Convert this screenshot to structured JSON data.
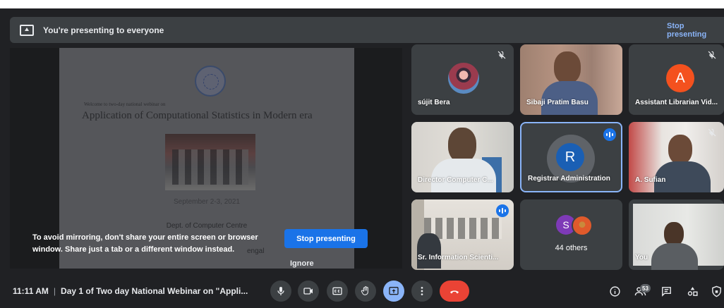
{
  "banner": {
    "text": "You're presenting to everyone",
    "stop_label": "Stop presenting"
  },
  "slide": {
    "welcome": "Welcome to two-day national webinar on",
    "title": "Application of Computational Statistics in Modern era",
    "dates": "September 2-3, 2021",
    "dept": "Dept. of Computer Centre",
    "region": "engal"
  },
  "mirror_warning": {
    "text": "To avoid mirroring, don't share your entire screen or browser window. Share just a tab or a different window instead.",
    "stop_label": "Stop presenting",
    "ignore_label": "Ignore"
  },
  "participants": [
    {
      "name": "sújit Bera",
      "muted": true,
      "speaking": false
    },
    {
      "name": "Sibaji Pratim Basu",
      "muted": false,
      "speaking": false
    },
    {
      "name": "Assistant Librarian Vid...",
      "muted": true,
      "speaking": false,
      "avatar_letter": "A",
      "avatar_color": "#f4511e"
    },
    {
      "name": "Director Computer C...",
      "muted": false,
      "speaking": false
    },
    {
      "name": "Registrar Administration",
      "muted": false,
      "speaking": true,
      "avatar_letter": "R",
      "avatar_color": "#1a5fb4"
    },
    {
      "name": "A. Sufian",
      "muted": true,
      "speaking": false
    },
    {
      "name": "Sr. Information Scienti...",
      "muted": false,
      "speaking": true
    },
    {
      "name": "44 others",
      "others_initial": "S",
      "others_color": "#7e3ab7"
    },
    {
      "name": "You",
      "muted": false,
      "speaking": false
    }
  ],
  "bottombar": {
    "time": "11:11 AM",
    "separator": "|",
    "meeting_title": "Day 1 of Two day National Webinar on \"Appli...",
    "participant_count": "53"
  },
  "colors": {
    "background": "#202124",
    "tile": "#3c4043",
    "accent": "#8ab4f8",
    "primary_button": "#1a73e8",
    "end_call": "#ea4335"
  }
}
